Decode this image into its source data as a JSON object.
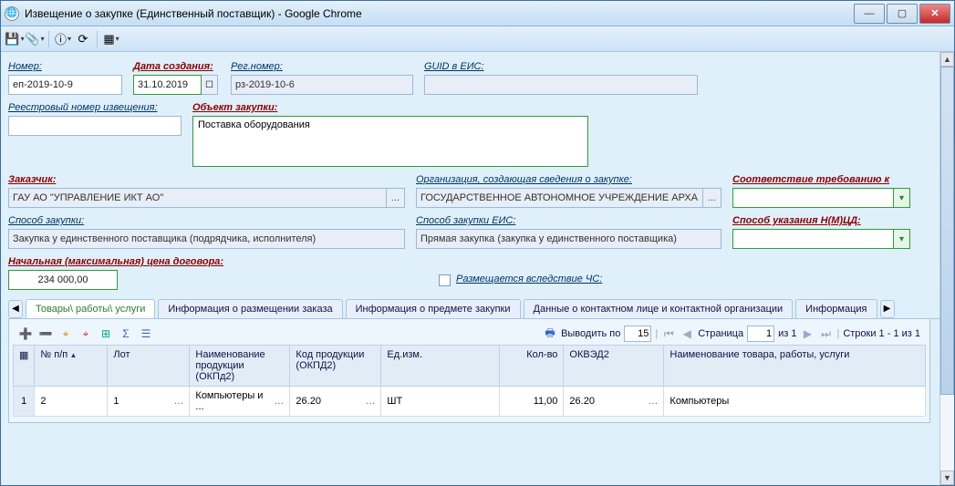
{
  "window": {
    "title": "Извещение о закупке (Единственный поставщик) - Google Chrome"
  },
  "toolbar": {
    "save_icon": "💾",
    "attach_icon": "📎",
    "info_icon": "ⓘ",
    "refresh_icon": "⟳",
    "columns_icon": "▦"
  },
  "fields": {
    "number": {
      "label": "Номер:",
      "value": "еп-2019-10-9"
    },
    "create_date": {
      "label": "Дата создания:",
      "value": "31.10.2019"
    },
    "reg_number": {
      "label": "Рег.номер:",
      "value": "рз-2019-10-6"
    },
    "guid": {
      "label": "GUID в ЕИС:",
      "value": ""
    },
    "reestr_no": {
      "label": "Реестровый номер извещения:",
      "value": ""
    },
    "object": {
      "label": "Объект закупки:",
      "value": "Поставка оборудования"
    },
    "customer": {
      "label": "Заказчик:",
      "value": "ГАУ АО \"УПРАВЛЕНИЕ ИКТ АО\""
    },
    "org_info": {
      "label": "Организация, создающая сведения о закупке:",
      "value": "ГОСУДАРСТВЕННОЕ АВТОНОМНОЕ УЧРЕЖДЕНИЕ АРХАН"
    },
    "compliance": {
      "label": "Соответствие требованию к",
      "value": ""
    },
    "method": {
      "label": "Способ закупки:",
      "value": "Закупка у единственного поставщика (подрядчика, исполнителя)"
    },
    "method_eis": {
      "label": "Способ закупки ЕИС:",
      "value": "Прямая закупка (закупка у единственного поставщика)"
    },
    "nmcd_method": {
      "label": "Способ указания Н(М)ЦД:",
      "value": ""
    },
    "nmcd_price": {
      "label": "Начальная (максимальная) цена договора:",
      "value": "234 000,00"
    },
    "chs": {
      "label": "Размещается вследствие ЧС:"
    }
  },
  "tabs": {
    "items": [
      "Товары\\ работы\\ услуги",
      "Информация о размещении заказа",
      "Информация о предмете закупки",
      "Данные о контактном лице и контактной организации",
      "Информация"
    ]
  },
  "grid": {
    "output_by_label": "Выводить по",
    "output_by_value": "15",
    "page_label": "Страница",
    "page_value": "1",
    "page_of": "из 1",
    "rows_info": "Строки 1 - 1 из 1",
    "headers": {
      "npp": "№ п/п",
      "lot": "Лот",
      "name": "Наименование продукции (ОКПд2)",
      "code": "Код продукции (ОКПД2)",
      "unit": "Ед.изм.",
      "qty": "Кол-во",
      "okved": "ОКВЭД2",
      "prod_name": "Наименование товара, работы, услуги"
    },
    "row": {
      "idx": "1",
      "npp": "2",
      "lot": "1",
      "name": "Компьютеры и ...",
      "code": "26.20",
      "unit": "ШТ",
      "qty": "11,00",
      "okved": "26.20",
      "prod_name": "Компьютеры"
    }
  },
  "chart_data": {
    "type": "table",
    "columns": [
      "№ п/п",
      "Лот",
      "Наименование продукции (ОКПд2)",
      "Код продукции (ОКПД2)",
      "Ед.изм.",
      "Кол-во",
      "ОКВЭД2",
      "Наименование товара, работы, услуги"
    ],
    "rows": [
      [
        "2",
        "1",
        "Компьютеры и ...",
        "26.20",
        "ШТ",
        "11,00",
        "26.20",
        "Компьютеры"
      ]
    ]
  }
}
